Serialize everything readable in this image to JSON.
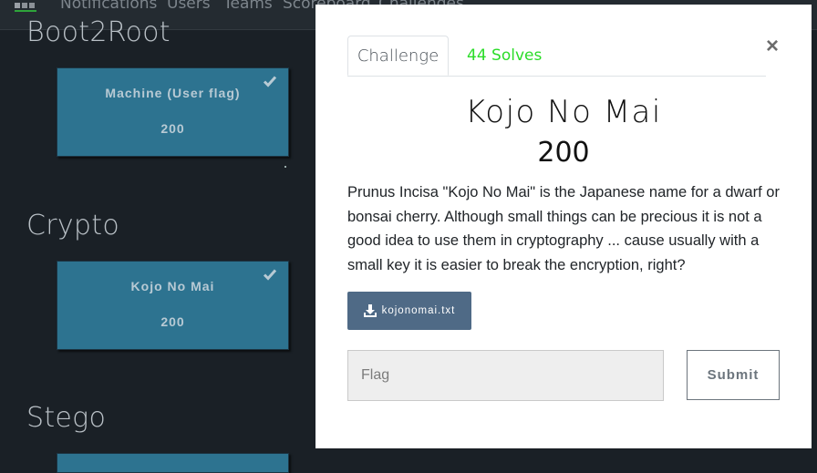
{
  "navbar": {
    "links": [
      "Notifications",
      "Users",
      "Teams",
      "Scoreboard",
      "Challenges"
    ]
  },
  "categories": [
    {
      "title": "Boot2Root",
      "challenges": [
        {
          "name": "Machine (User flag)",
          "value": "200",
          "solved": true
        }
      ]
    },
    {
      "title": "Crypto",
      "challenges": [
        {
          "name": "Kojo No Mai",
          "value": "200",
          "solved": true
        }
      ]
    },
    {
      "title": "Stego",
      "challenges": []
    }
  ],
  "modal": {
    "tabs": {
      "challenge": "Challenge",
      "solves": "44 Solves"
    },
    "close_symbol": "×",
    "title": "Kojo No Mai",
    "value": "200",
    "description": "Prunus Incisa \"Kojo No Mai\" is the Japanese name for a dwarf or bonsai cherry. Although small things can be precious it is not a good idea to use them in cryptography ... cause usually with a small key it is easier to break the encryption, right?",
    "file": {
      "name": "kojonomai.txt",
      "icon": "download-icon"
    },
    "flag_input": {
      "placeholder": "Flag",
      "value": ""
    },
    "submit_label": "Submit"
  },
  "colors": {
    "background": "#1a2026",
    "card": "#2d7390",
    "solves_accent": "#2bdc28",
    "download_button": "#4f6a86"
  }
}
